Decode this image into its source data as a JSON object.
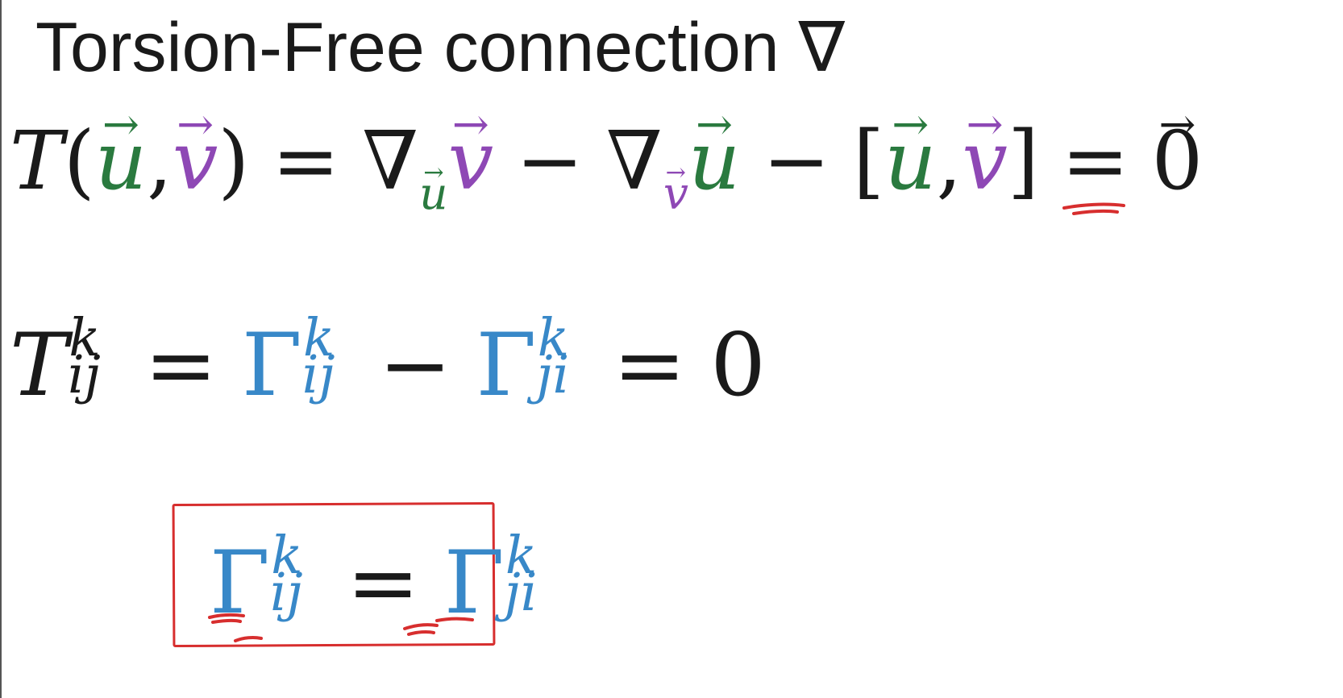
{
  "title": {
    "text": "Torsion-Free connection ∇"
  },
  "eq1": {
    "T": "T",
    "lparen": "(",
    "u": "u",
    "comma": ",",
    "v": "v",
    "rparen": ")",
    "eq": "=",
    "nabla": "∇",
    "minus": "−",
    "lbracket": "[",
    "rbracket": "]",
    "zero": "0",
    "arrow": "→"
  },
  "eq2": {
    "T": "T",
    "sup": "k",
    "sub_ij": "ij",
    "sub_ji": "ji",
    "eq": "=",
    "gamma": "Γ",
    "minus": "−",
    "zero": "0"
  },
  "eq3": {
    "gamma": "Γ",
    "sup": "k",
    "sub_ij": "ij",
    "sub_ji": "ji",
    "eq": "="
  },
  "colors": {
    "u_vector": "#2a7a3f",
    "v_vector": "#8e48b5",
    "christoffel": "#3888c8",
    "annotation": "#d72e2e"
  }
}
